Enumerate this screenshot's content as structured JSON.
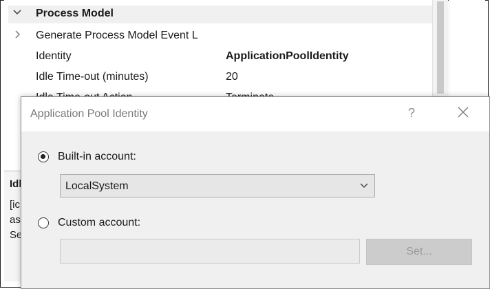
{
  "property_grid": {
    "category": {
      "label": "Process Model",
      "expander": "chevron-down-icon"
    },
    "rows": [
      {
        "name": "Generate Process Model Event L",
        "value": "",
        "expander": "chevron-right-icon"
      },
      {
        "name": "Identity",
        "value": "ApplicationPoolIdentity"
      },
      {
        "name": "Idle Time-out (minutes)",
        "value": "20"
      },
      {
        "name": "Idle Time-out Action",
        "value": "Terminate"
      }
    ]
  },
  "description": {
    "title": "Idl",
    "lines": [
      "[ic",
      "as",
      "Se"
    ]
  },
  "dialog": {
    "title": "Application Pool Identity",
    "help": "?",
    "builtin_label": "Built-in account:",
    "builtin_selected": true,
    "builtin_value": "LocalSystem",
    "custom_label": "Custom account:",
    "custom_selected": false,
    "custom_value": "",
    "set_button": "Set..."
  }
}
